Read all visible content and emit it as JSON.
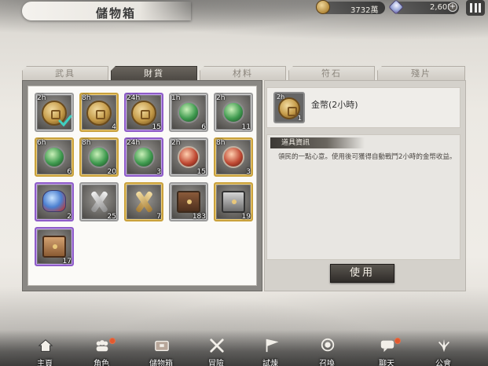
{
  "header": {
    "title": "儲物箱",
    "gold_amount": "3732萬",
    "gem_amount": "2,605"
  },
  "tabs": [
    {
      "label": "武具",
      "active": false
    },
    {
      "label": "財貨",
      "active": true
    },
    {
      "label": "材料",
      "active": false
    },
    {
      "label": "符石",
      "active": false
    },
    {
      "label": "殘片",
      "active": false
    }
  ],
  "inventory": [
    {
      "icon": "gold-coin-icon",
      "frame": "grey",
      "time": "2h",
      "count": "",
      "selected": true
    },
    {
      "icon": "gold-coin-icon",
      "frame": "gold",
      "time": "8h",
      "count": "4",
      "selected": false
    },
    {
      "icon": "gold-coin-icon",
      "frame": "purple",
      "time": "24h",
      "count": "15",
      "selected": false
    },
    {
      "icon": "green-orb-icon",
      "frame": "grey",
      "time": "1h",
      "count": "6",
      "selected": false
    },
    {
      "icon": "green-orb-icon",
      "frame": "grey",
      "time": "2h",
      "count": "11",
      "selected": false
    },
    {
      "icon": "green-orb-icon",
      "frame": "gold",
      "time": "6h",
      "count": "6",
      "selected": false
    },
    {
      "icon": "green-orb-icon",
      "frame": "gold",
      "time": "8h",
      "count": "20",
      "selected": false
    },
    {
      "icon": "green-orb-icon",
      "frame": "purple",
      "time": "24h",
      "count": "3",
      "selected": false
    },
    {
      "icon": "red-orb-icon",
      "frame": "grey",
      "time": "2h",
      "count": "15",
      "selected": false
    },
    {
      "icon": "red-orb-icon",
      "frame": "gold",
      "time": "8h",
      "count": "3",
      "selected": false
    },
    {
      "icon": "pouch-icon",
      "frame": "purple",
      "time": "",
      "count": "2",
      "selected": false
    },
    {
      "icon": "silver-cross-icon",
      "frame": "grey",
      "time": "",
      "count": "25",
      "selected": false
    },
    {
      "icon": "gold-cross-icon",
      "frame": "gold",
      "time": "",
      "count": "7",
      "selected": false
    },
    {
      "icon": "brown-chest-icon",
      "frame": "grey",
      "time": "",
      "count": "183",
      "selected": false
    },
    {
      "icon": "steel-chest-icon",
      "frame": "gold",
      "time": "",
      "count": "19",
      "selected": false
    },
    {
      "icon": "copper-chest-icon",
      "frame": "purple",
      "time": "",
      "count": "17",
      "selected": false
    }
  ],
  "detail": {
    "time": "2h",
    "count": "1",
    "name": "金幣(2小時)",
    "section_title": "道具資訊",
    "description": "領民的一點心意。使用後可獲得自動戰鬥2小時的金幣收益。",
    "use_button": "使用"
  },
  "nav": [
    {
      "label": "主頁",
      "icon": "home-icon",
      "badge": false,
      "active": false
    },
    {
      "label": "角色",
      "icon": "character-icon",
      "badge": true,
      "active": false
    },
    {
      "label": "儲物箱",
      "icon": "storage-icon",
      "badge": false,
      "active": true
    },
    {
      "label": "冒險",
      "icon": "adventure-icon",
      "badge": false,
      "active": false
    },
    {
      "label": "試煉",
      "icon": "trial-icon",
      "badge": false,
      "active": false
    },
    {
      "label": "召喚",
      "icon": "summon-icon",
      "badge": false,
      "active": false
    },
    {
      "label": "聊天",
      "icon": "chat-icon",
      "badge": true,
      "active": false
    },
    {
      "label": "公會",
      "icon": "guild-icon",
      "badge": false,
      "active": false
    }
  ]
}
